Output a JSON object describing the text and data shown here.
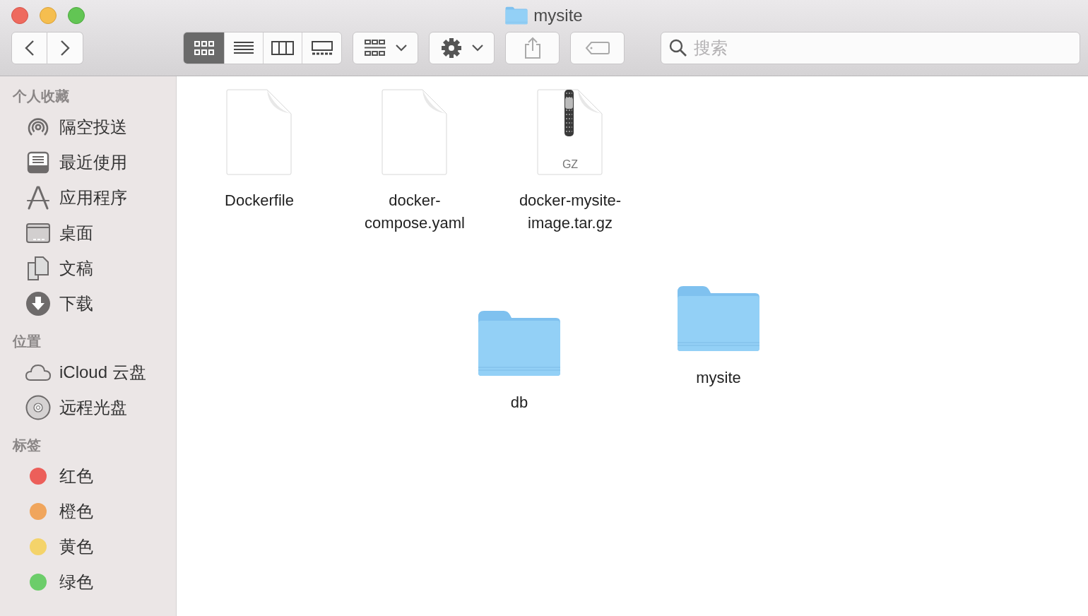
{
  "window": {
    "title": "mysite"
  },
  "toolbar": {
    "view_modes": [
      {
        "kind": "icons",
        "selected": true
      },
      {
        "kind": "list",
        "selected": false
      },
      {
        "kind": "columns",
        "selected": false
      },
      {
        "kind": "gallery",
        "selected": false
      }
    ],
    "search": {
      "placeholder": "搜索"
    }
  },
  "sidebar": {
    "sections": [
      {
        "heading": "个人收藏",
        "items": [
          {
            "label": "隔空投送",
            "kind": "airdrop"
          },
          {
            "label": "最近使用",
            "kind": "recents"
          },
          {
            "label": "应用程序",
            "kind": "apps"
          },
          {
            "label": "桌面",
            "kind": "desktop"
          },
          {
            "label": "文稿",
            "kind": "documents"
          },
          {
            "label": "下载",
            "kind": "downloads"
          }
        ]
      },
      {
        "heading": "位置",
        "items": [
          {
            "label": "iCloud 云盘",
            "kind": "cloud"
          },
          {
            "label": "远程光盘",
            "kind": "disc"
          }
        ]
      },
      {
        "heading": "标签",
        "items": [
          {
            "label": "红色",
            "kind": "tag",
            "color": "#ec5f5a"
          },
          {
            "label": "橙色",
            "kind": "tag",
            "color": "#f0a55c"
          },
          {
            "label": "黄色",
            "kind": "tag",
            "color": "#f4d36a"
          },
          {
            "label": "绿色",
            "kind": "tag",
            "color": "#6ccd6a"
          }
        ]
      }
    ]
  },
  "files": [
    {
      "name": "Dockerfile",
      "kind": "document"
    },
    {
      "name": "docker-compose.yaml",
      "kind": "document"
    },
    {
      "name": "docker-mysite-image.tar.gz",
      "kind": "archive",
      "badge": "GZ"
    },
    {
      "name": "db",
      "kind": "folder"
    },
    {
      "name": "mysite",
      "kind": "folder"
    }
  ]
}
